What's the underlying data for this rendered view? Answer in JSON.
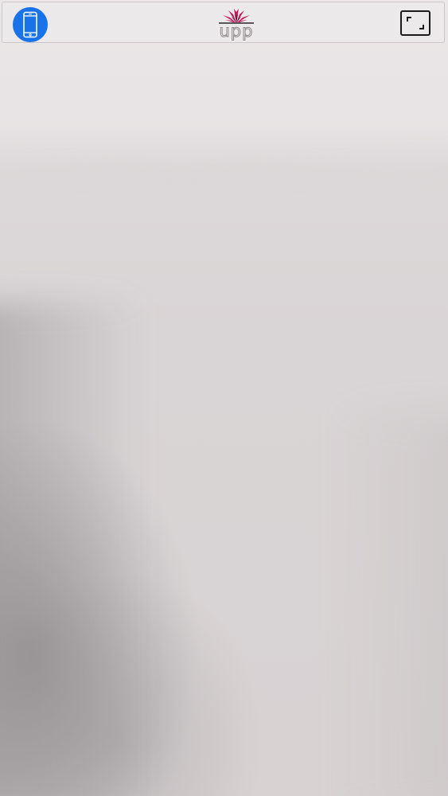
{
  "app": {
    "logo_text": "upp",
    "brand_color": "#c2185b",
    "accent_color": "#1872e8"
  },
  "top_bar": {
    "left_button_icon": "smartphone-icon",
    "logo_icon": "upp-logo-burst-icon",
    "right_button_icon": "fullscreen-icon"
  },
  "main": {
    "view": "camera-preview"
  }
}
